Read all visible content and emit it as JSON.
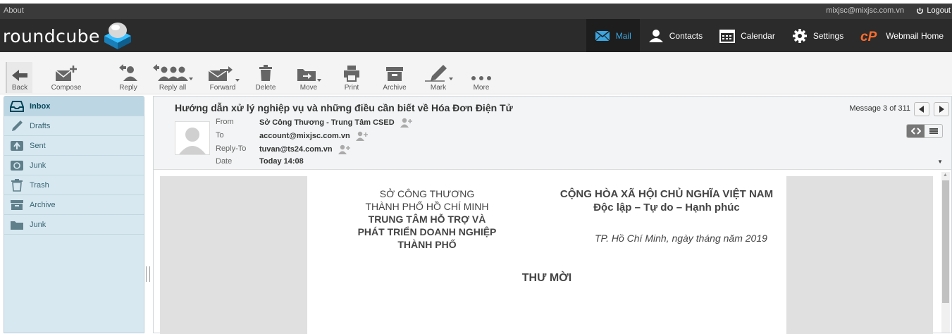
{
  "topbar": {
    "about": "About",
    "user_email": "mixjsc@mixjsc.com.vn",
    "logout": "Logout"
  },
  "logo": {
    "text": "roundcube"
  },
  "tasks": [
    {
      "label": "Mail",
      "icon": "envelope-icon",
      "active": true
    },
    {
      "label": "Contacts",
      "icon": "contacts-icon"
    },
    {
      "label": "Calendar",
      "icon": "calendar-icon"
    },
    {
      "label": "Settings",
      "icon": "gear-icon"
    },
    {
      "label": "Webmail Home",
      "icon": "cpanel-icon"
    }
  ],
  "toolbar": {
    "back": "Back",
    "compose": "Compose",
    "reply": "Reply",
    "reply_all": "Reply all",
    "forward": "Forward",
    "delete": "Delete",
    "move": "Move",
    "print": "Print",
    "archive": "Archive",
    "mark": "Mark",
    "more": "More"
  },
  "folders": [
    {
      "label": "Inbox",
      "icon": "inbox-icon",
      "selected": true
    },
    {
      "label": "Drafts",
      "icon": "pencil-icon"
    },
    {
      "label": "Sent",
      "icon": "sent-icon"
    },
    {
      "label": "Junk",
      "icon": "junk-icon"
    },
    {
      "label": "Trash",
      "icon": "trash-icon"
    },
    {
      "label": "Archive",
      "icon": "archive-icon"
    },
    {
      "label": "Junk",
      "icon": "folder-icon"
    }
  ],
  "message": {
    "subject": "Hướng dẫn xử lý nghiệp vụ và những điều cần biết về Hóa Đơn Điện Tử",
    "count": "Message 3 of 311",
    "from_label": "From",
    "from_value": "Sở Công Thương - Trung Tâm CSED",
    "to_label": "To",
    "to_value": "account@mixjsc.com.vn",
    "replyto_label": "Reply-To",
    "replyto_value": "tuvan@ts24.com.vn",
    "date_label": "Date",
    "date_value": "Today 14:08"
  },
  "document": {
    "left_line1": "SỞ CÔNG THƯƠNG",
    "left_line2": "THÀNH PHỐ HỒ CHÍ MINH",
    "left_line3": "TRUNG TÂM HỖ TRỢ VÀ",
    "left_line4": "PHÁT TRIỂN DOANH NGHIỆP",
    "left_line5": "THÀNH PHỐ",
    "right_line1": "CỘNG HÒA XÃ HỘI CHỦ NGHĨA VIỆT NAM",
    "right_line2": "Độc lập – Tự do – Hạnh phúc",
    "dateline": "TP. Hồ Chí Minh, ngày   tháng   năm 2019",
    "invite": "THƯ MỜI"
  },
  "colors": {
    "header_bg": "#2b2b2b",
    "accent": "#3aa5e0",
    "sidebar_bg": "#d8e8f0",
    "cpanel_orange": "#ff6c2c"
  }
}
